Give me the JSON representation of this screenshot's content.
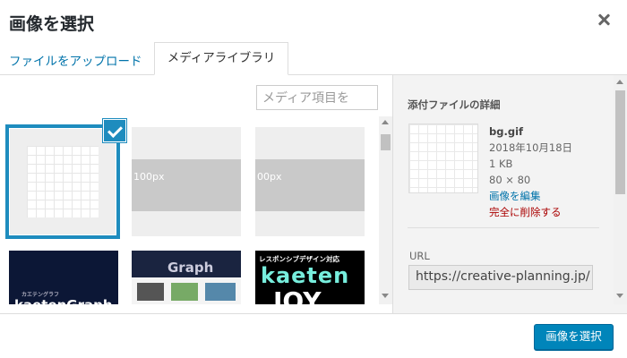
{
  "dialog": {
    "title": "画像を選択",
    "close_icon": "close-icon"
  },
  "tabs": [
    {
      "label": "ファイルをアップロード",
      "active": false
    },
    {
      "label": "メディアライブラリ",
      "active": true
    }
  ],
  "search": {
    "placeholder": "メディア項目を"
  },
  "grid": {
    "items": [
      {
        "type": "grid-placeholder",
        "selected": true
      },
      {
        "type": "gray-band",
        "label": "100px"
      },
      {
        "type": "gray-band",
        "label": "00px"
      },
      {
        "type": "dark-logo",
        "line1": "カエテングラフ",
        "line2": "kaetenGraph"
      },
      {
        "type": "website",
        "line1": "Graph"
      },
      {
        "type": "dark-joy",
        "line1": "レスポンシブデザイン対応",
        "line2": "kaeten",
        "line3": "JOY"
      }
    ]
  },
  "details": {
    "heading": "添付ファイルの詳細",
    "filename": "bg.gif",
    "date": "2018年10月18日",
    "size": "1 KB",
    "dimensions": "80 × 80",
    "edit_link": "画像を編集",
    "delete_link": "完全に削除する",
    "url_label": "URL",
    "url_value": "https://creative-planning.jp/"
  },
  "footer": {
    "select_button": "画像を選択"
  },
  "colors": {
    "primary": "#0085ba",
    "selected_border": "#1e8cbe",
    "link": "#0073aa",
    "delete": "#aa0000"
  }
}
